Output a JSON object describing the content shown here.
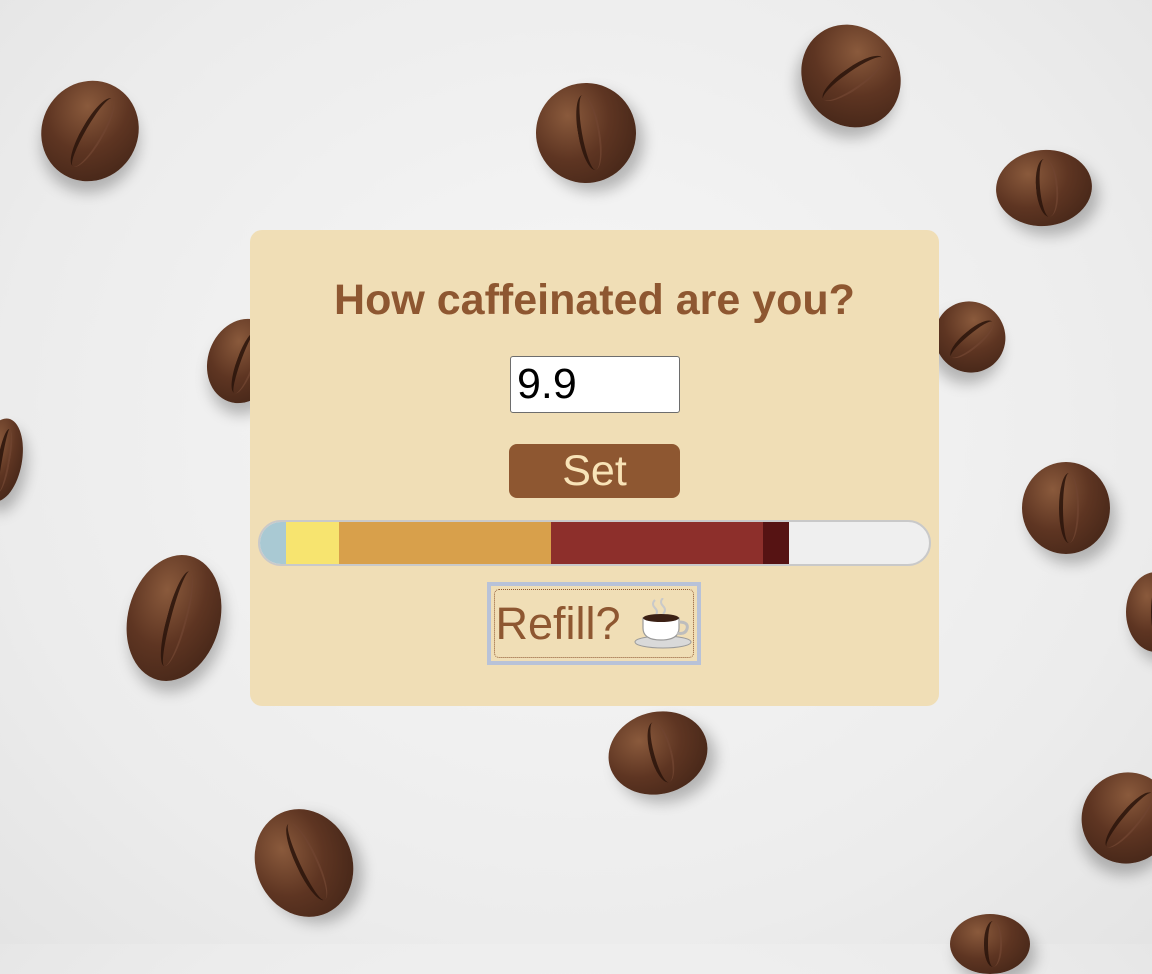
{
  "page": {
    "title": "How caffeinated are you?"
  },
  "input": {
    "value": "9.9"
  },
  "set_button": {
    "label": "Set"
  },
  "meter": {
    "level": 0.79,
    "segments": [
      {
        "name": "light-blue",
        "color": "#a9c9d3"
      },
      {
        "name": "yellow",
        "color": "#f7e46f"
      },
      {
        "name": "orange",
        "color": "#d8a04b"
      },
      {
        "name": "red",
        "color": "#8d2f2b"
      },
      {
        "name": "dark-red",
        "color": "#561313"
      }
    ],
    "empty_color": "#efefef"
  },
  "refill_button": {
    "label": "Refill?",
    "icon": "coffee-cup-icon"
  },
  "colors": {
    "card_background": "#f0deb6",
    "accent": "#8e5731",
    "button_text": "#f8e3b7"
  }
}
